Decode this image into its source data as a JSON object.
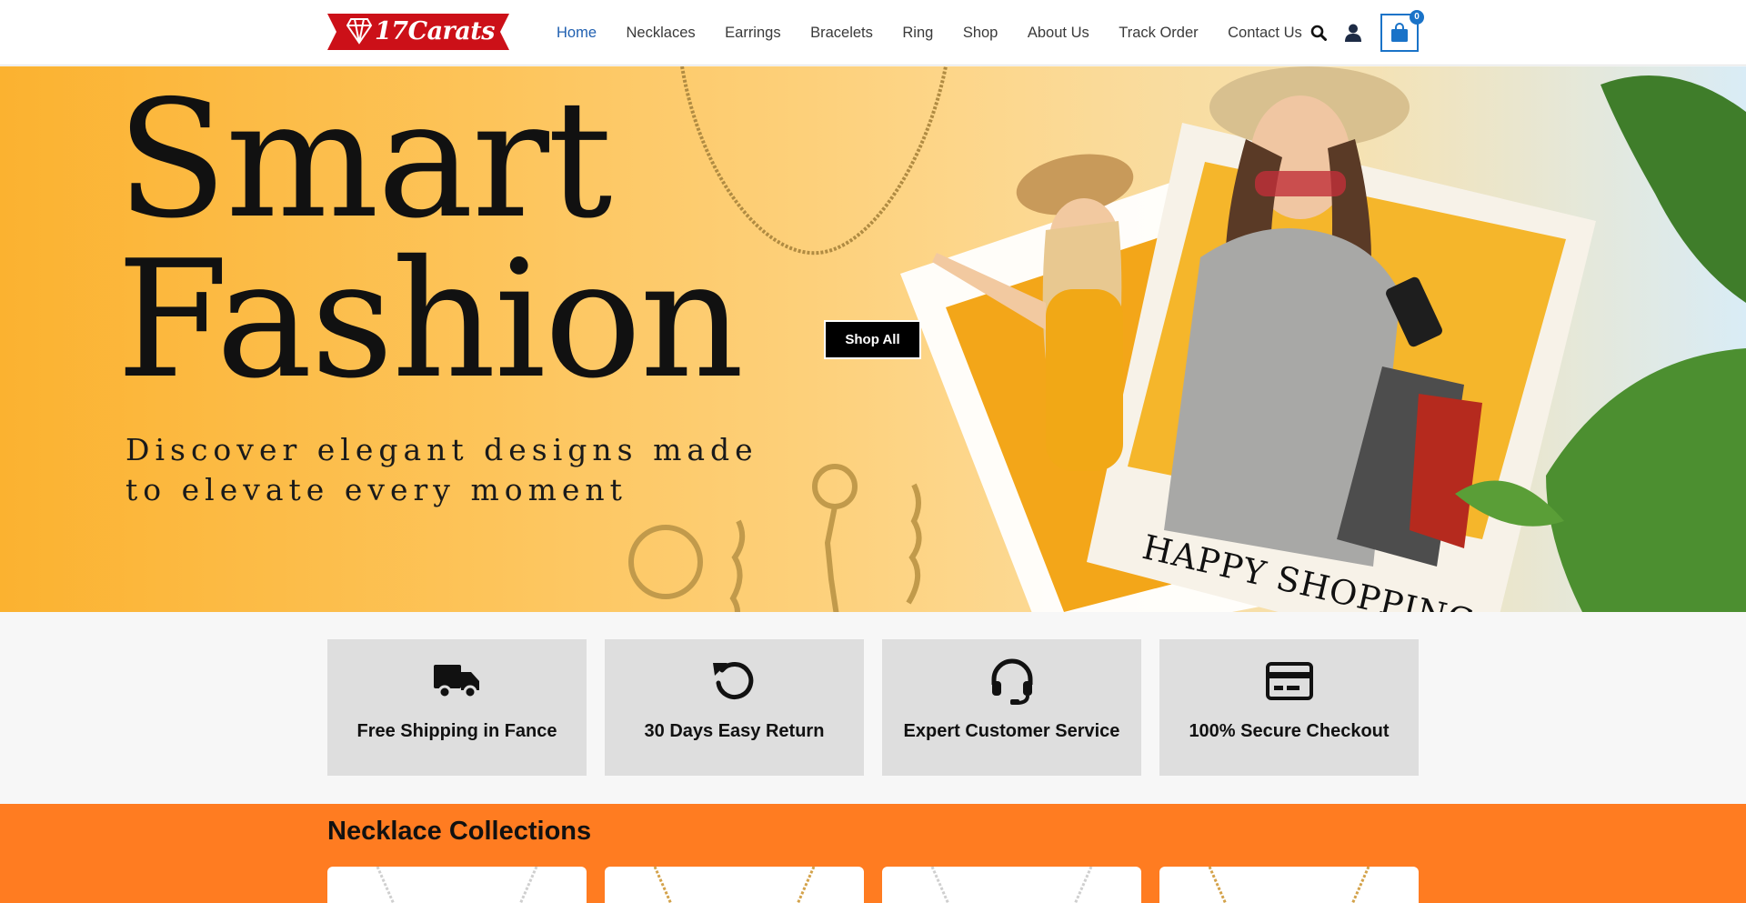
{
  "brand": {
    "logo_text": "17Carats",
    "accent": "#cc1018",
    "link_active": "#1f5fb0",
    "cart_accent": "#1a73c8"
  },
  "nav": {
    "items": [
      {
        "label": "Home",
        "active": true
      },
      {
        "label": "Necklaces"
      },
      {
        "label": "Earrings"
      },
      {
        "label": "Bracelets"
      },
      {
        "label": "Ring"
      },
      {
        "label": "Shop"
      },
      {
        "label": "About Us"
      },
      {
        "label": "Track Order"
      },
      {
        "label": "Contact Us"
      }
    ],
    "icons": [
      "search-icon",
      "user-icon",
      "shopping-bag-icon"
    ],
    "cart_count": "0"
  },
  "hero": {
    "title_line1": "Smart",
    "title_line2": "Fashion",
    "subtitle": "Discover elegant designs made to elevate every moment",
    "cta_label": "Shop All",
    "photo_caption": "HAPPY SHOPPING",
    "bg_colors": [
      "#fbb230",
      "#fdd68a",
      "#d9ecf6"
    ]
  },
  "features": [
    {
      "icon": "truck-icon",
      "label": "Free Shipping in Fance"
    },
    {
      "icon": "return-icon",
      "label": "30 Days Easy Return"
    },
    {
      "icon": "headset-icon",
      "label": "Expert Customer Service"
    },
    {
      "icon": "credit-card-icon",
      "label": "100% Secure Checkout"
    }
  ],
  "collections": {
    "title": "Necklace Collections",
    "bg_color": "#ff7c21"
  }
}
